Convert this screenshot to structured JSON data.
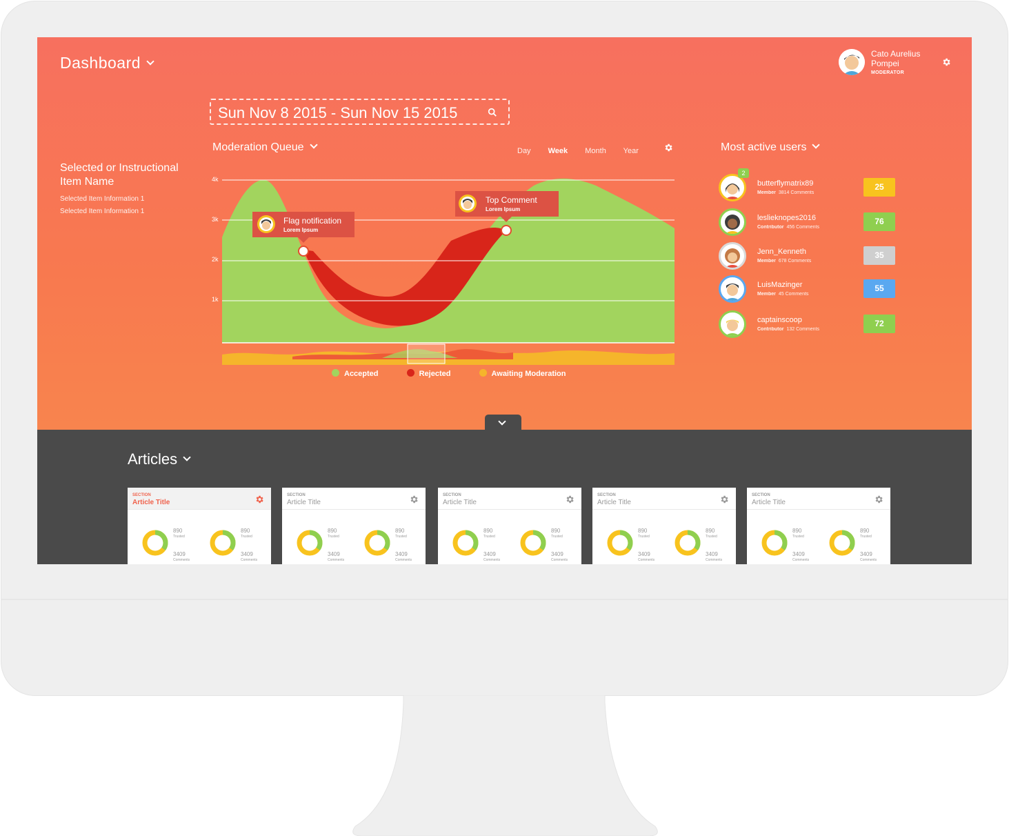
{
  "header": {
    "title": "Dashboard",
    "user": {
      "name": "Cato Aurelius Pompei",
      "role": "MODERATOR"
    }
  },
  "date_range": "Sun Nov 8 2015 - Sun Nov 15 2015",
  "selection": {
    "heading": "Selected or Instructional Item Name",
    "info": [
      "Selected Item Information 1",
      "Selected Item Information 1"
    ]
  },
  "moderation": {
    "title": "Moderation Queue",
    "ranges": [
      "Day",
      "Week",
      "Month",
      "Year"
    ],
    "active_range": "Week",
    "tooltips": [
      {
        "title": "Flag notification",
        "subtitle": "Lorem Ipsum"
      },
      {
        "title": "Top Comment",
        "subtitle": "Lorem Ipsum"
      }
    ],
    "legend": [
      "Accepted",
      "Rejected",
      "Awaiting Moderation"
    ]
  },
  "chart_data": {
    "type": "area",
    "y_ticks": [
      "4k",
      "3k",
      "2k",
      "1k"
    ],
    "ylim": [
      0,
      4000
    ],
    "series": [
      {
        "name": "Accepted",
        "color": "#a2d45e",
        "values": [
          2600,
          4000,
          2300,
          1000,
          400,
          1200,
          2800,
          3900,
          4000,
          3600,
          2600
        ]
      },
      {
        "name": "Rejected",
        "color": "#d8251a",
        "values": [
          0,
          0,
          2300,
          1600,
          1300,
          1800,
          2800,
          0,
          0,
          0,
          0
        ]
      }
    ],
    "grid": true
  },
  "most_active": {
    "title": "Most active users",
    "users": [
      {
        "name": "butterflymatrix89",
        "role": "Member",
        "comments": "3814 Comments",
        "score": "25",
        "color": "#f8c31e",
        "badge": "2"
      },
      {
        "name": "leslieknopes2016",
        "role": "Contributor",
        "comments": "456 Comments",
        "score": "76",
        "color": "#8fcf4f",
        "badge": ""
      },
      {
        "name": "Jenn_Kenneth",
        "role": "Member",
        "comments": "678 Comments",
        "score": "35",
        "color": "#cfcfcf",
        "badge": ""
      },
      {
        "name": "LuisMazinger",
        "role": "Member",
        "comments": "45 Comments",
        "score": "55",
        "color": "#5aa8f0",
        "badge": ""
      },
      {
        "name": "captainscoop",
        "role": "Contributor",
        "comments": "132 Comments",
        "score": "72",
        "color": "#8fcf4f",
        "badge": ""
      }
    ]
  },
  "articles": {
    "title": "Articles",
    "cards": [
      {
        "section": "SECTION",
        "title": "Article Title",
        "trusted": "890",
        "trusted_label": "Trusted",
        "comments": "3409",
        "comments_label": "Comments",
        "trusted_fraction": 0.35
      },
      {
        "section": "SECTION",
        "title": "Article Title",
        "trusted": "890",
        "trusted_label": "Trusted",
        "comments": "3409",
        "comments_label": "Comments",
        "trusted_fraction": 0.35
      },
      {
        "section": "SECTION",
        "title": "Article Title",
        "trusted": "890",
        "trusted_label": "Trusted",
        "comments": "3409",
        "comments_label": "Comments",
        "trusted_fraction": 0.35
      },
      {
        "section": "SECTION",
        "title": "Article Title",
        "trusted": "890",
        "trusted_label": "Trusted",
        "comments": "3409",
        "comments_label": "Comments",
        "trusted_fraction": 0.35
      },
      {
        "section": "SECTION",
        "title": "Article Title",
        "trusted": "890",
        "trusted_label": "Trusted",
        "comments": "3409",
        "comments_label": "Comments",
        "trusted_fraction": 0.35
      }
    ]
  }
}
